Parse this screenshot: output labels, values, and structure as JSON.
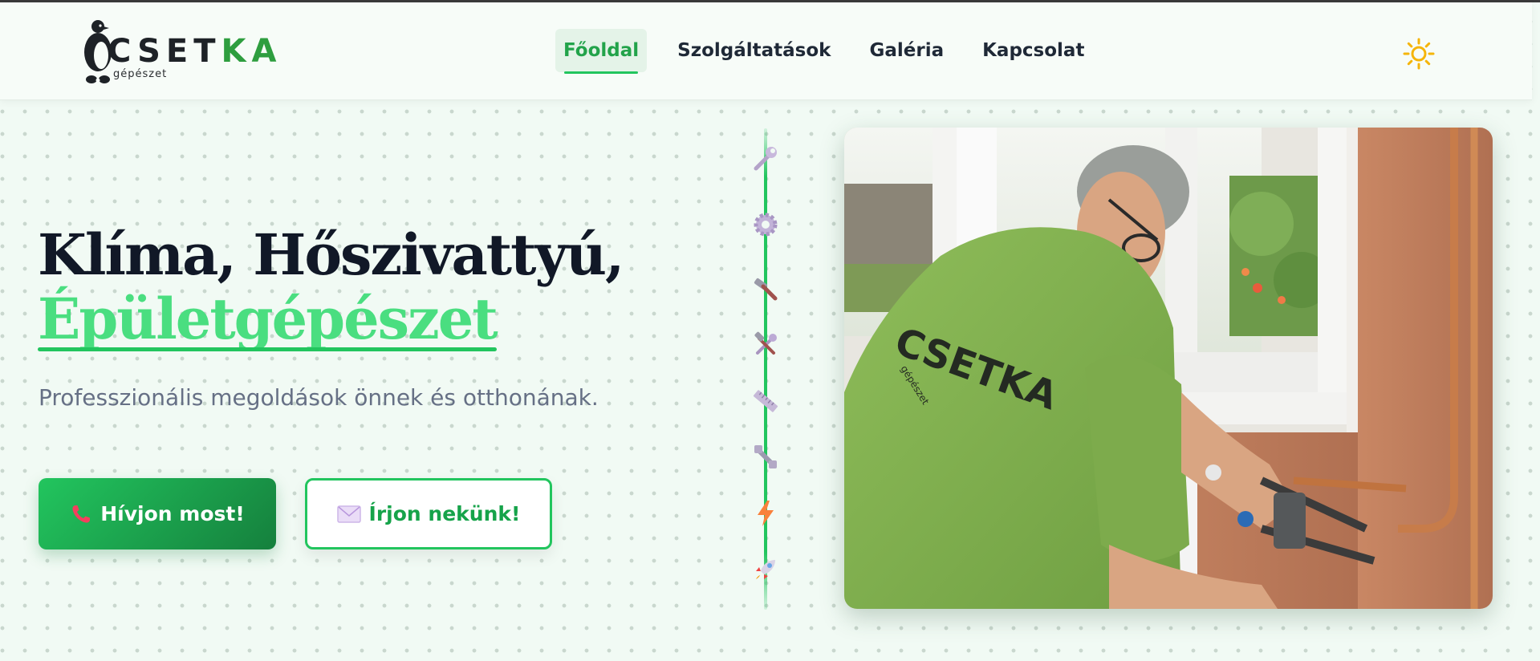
{
  "brand": {
    "logo_text_dark": "CSET",
    "logo_text_accent": "KA",
    "logo_subtitle": "gépészet"
  },
  "nav": {
    "items": [
      {
        "label": "Főoldal",
        "active": true
      },
      {
        "label": "Szolgáltatások",
        "active": false
      },
      {
        "label": "Galéria",
        "active": false
      },
      {
        "label": "Kapcsolat",
        "active": false
      }
    ],
    "theme_icon": "sun-icon"
  },
  "hero": {
    "title_line1": "Klíma, Hőszivattyú,",
    "title_line2": "Épületgépészet",
    "subtitle": "Professzionális megoldások önnek és otthonának.",
    "primary_button": "Hívjon most!",
    "secondary_button": "Írjon nekünk!",
    "primary_icon": "phone-icon",
    "secondary_icon": "envelope-icon"
  },
  "timeline_icons": [
    "wrench-icon",
    "gear-icon",
    "hammer-icon",
    "hammer-wrench-icon",
    "ruler-icon",
    "bolt-nut-icon",
    "lightning-icon",
    "rocket-icon"
  ],
  "photo": {
    "shirt_text": "CSETKA",
    "shirt_subtext": "gépészet"
  },
  "colors": {
    "accent": "#22c55e",
    "accent_dark": "#15803d",
    "title": "#111827",
    "subtitle": "#667085"
  }
}
